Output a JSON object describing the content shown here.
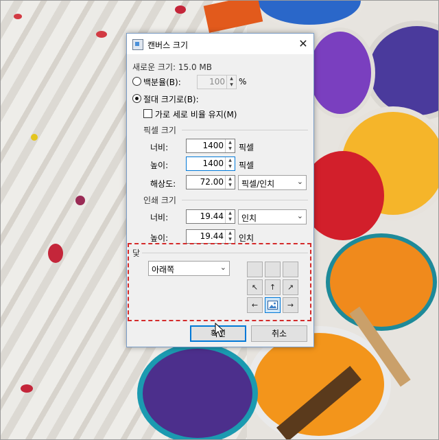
{
  "dialog": {
    "title": "캔버스 크기",
    "close_glyph": "✕",
    "new_size": "새로운 크기: 15.0 MB",
    "by_percent_label": "백분율(B):",
    "percent_value": "100",
    "percent_unit": "%",
    "by_absolute_label": "절대 크기로(B):",
    "maintain_aspect_label": "가로 세로 비율 유지(M)",
    "pixel_size_header": "픽셀 크기",
    "width_label": "너비:",
    "width_value": "1400",
    "width_unit": "픽셀",
    "height_label": "높이:",
    "height_value": "1400",
    "height_unit": "픽셀",
    "resolution_label": "해상도:",
    "resolution_value": "72.00",
    "resolution_unit": "픽셀/인치",
    "print_size_header": "인쇄 크기",
    "print_width_label": "너비:",
    "print_width_value": "19.44",
    "print_width_unit": "인치",
    "print_height_label": "높이:",
    "print_height_value": "19.44",
    "print_height_unit": "인치",
    "anchor_header": "닻",
    "anchor_value": "아래쪽",
    "ok_label": "확인",
    "cancel_label": "취소"
  },
  "icons": {
    "app": "canvas-size-icon",
    "anchor_arrows": [
      "",
      "",
      "",
      "↖",
      "↑",
      "↗",
      "←",
      "image",
      "→"
    ]
  },
  "colors": {
    "accent": "#0078d7",
    "highlight_box": "#d42a2a"
  }
}
